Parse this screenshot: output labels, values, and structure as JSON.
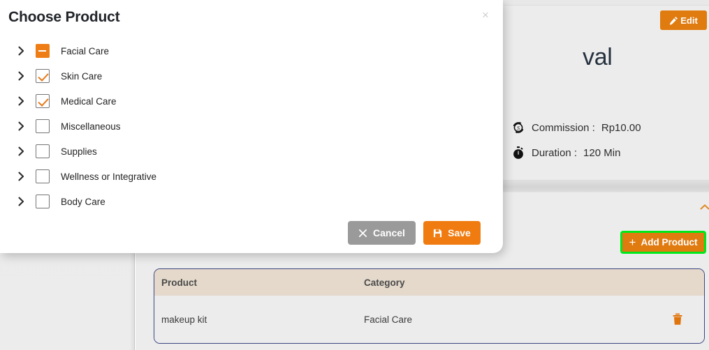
{
  "modal": {
    "title": "Choose Product",
    "close_icon": "close-icon",
    "tree_items": [
      {
        "label": "Facial Care",
        "state": "indeterminate",
        "arrow": "chevron-right-icon"
      },
      {
        "label": "Skin Care",
        "state": "checked",
        "arrow": "chevron-right-icon"
      },
      {
        "label": "Medical Care",
        "state": "checked",
        "arrow": "chevron-right-icon"
      },
      {
        "label": "Miscellaneous",
        "state": "unchecked",
        "arrow": "chevron-right-icon"
      },
      {
        "label": "Supplies",
        "state": "unchecked",
        "arrow": "chevron-right-icon"
      },
      {
        "label": "Wellness or Integrative",
        "state": "unchecked",
        "arrow": "chevron-right-icon"
      },
      {
        "label": "Body Care",
        "state": "unchecked",
        "arrow": "chevron-right-icon"
      }
    ],
    "cancel_label": "Cancel",
    "save_label": "Save",
    "cancel_icon": "x-icon",
    "save_icon": "floppy-disk-icon"
  },
  "page": {
    "edit_label": "Edit",
    "edit_icon": "pencil-icon",
    "detail_title": "val",
    "commission_icon": "currency-refresh-icon",
    "commission_label": "Commission :",
    "commission_value": "Rp10.00",
    "duration_icon": "stopwatch-icon",
    "duration_label": "Duration :",
    "duration_value": "120 Min",
    "collapse_icon": "chevron-up-icon",
    "add_product_label": "Add Product",
    "add_product_icon": "plus-icon",
    "table": {
      "columns": [
        "Product",
        "Category"
      ],
      "rows": [
        {
          "product": "makeup kit",
          "category": "Facial Care",
          "delete_icon": "trash-icon"
        }
      ]
    }
  },
  "colors": {
    "accent_orange": "#ef7d16",
    "edit_orange": "#e07b10",
    "highlight_green": "#00e81a",
    "table_border_navy": "#3b4580",
    "table_header_beige": "#e4d9cb",
    "cancel_gray": "#9a9a9a"
  }
}
